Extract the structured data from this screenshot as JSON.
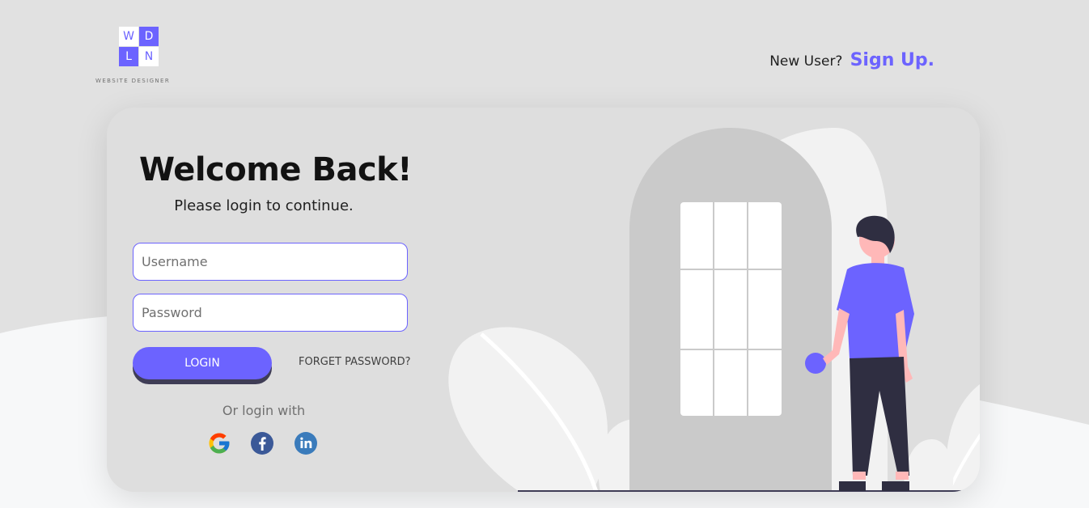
{
  "logo": {
    "cells": [
      "W",
      "D",
      "L",
      "N"
    ],
    "tagline": "WEBSITE DESIGNER"
  },
  "header": {
    "signup_prompt": "New User?",
    "signup_link": "Sign Up."
  },
  "login": {
    "title": "Welcome Back!",
    "subtitle": "Please login to continue.",
    "username_placeholder": "Username",
    "password_placeholder": "Password",
    "login_button": "LOGIN",
    "forget_password": "FORGET PASSWORD?",
    "or_login_with": "Or login with",
    "social_icons": [
      "google-icon",
      "facebook-icon",
      "linkedin-icon"
    ]
  },
  "colors": {
    "accent": "#6c63ff",
    "dark": "#3f3d56",
    "background": "#e1e1e1",
    "card": "#dedede"
  }
}
